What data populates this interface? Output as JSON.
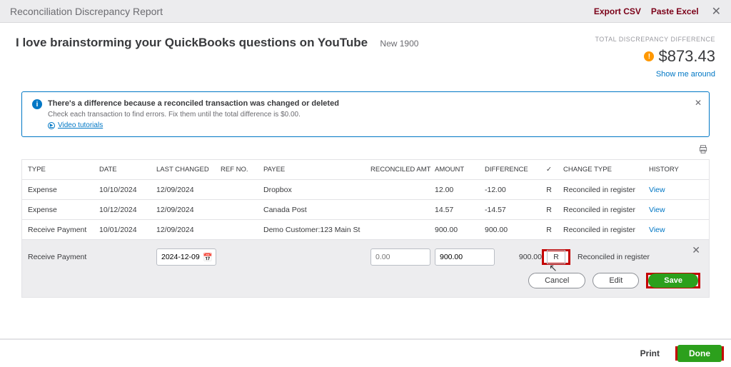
{
  "topbar": {
    "title": "Reconciliation Discrepancy Report",
    "export_csv": "Export CSV",
    "paste_excel": "Paste Excel"
  },
  "header": {
    "headline": "I love brainstorming your QuickBooks questions on YouTube",
    "sub": "New 1900",
    "caption": "TOTAL DISCREPANCY DIFFERENCE",
    "amount": "$873.43",
    "showme": "Show me around"
  },
  "alert": {
    "strong": "There's a difference because a reconciled transaction was changed or deleted",
    "sub": "Check each transaction to find errors. Fix them until the total difference is $0.00.",
    "video": "Video tutorials"
  },
  "columns": {
    "type": "TYPE",
    "date": "DATE",
    "last": "LAST CHANGED",
    "ref": "REF NO.",
    "payee": "PAYEE",
    "recon": "RECONCILED AMT",
    "amt": "AMOUNT",
    "diff": "DIFFERENCE",
    "chk": "✓",
    "ctype": "CHANGE TYPE",
    "hist": "HISTORY"
  },
  "rows": [
    {
      "type": "Expense",
      "date": "10/10/2024",
      "last": "12/09/2024",
      "ref": "",
      "payee": "Dropbox",
      "recon": "",
      "amt": "12.00",
      "diff": "-12.00",
      "chk": "R",
      "ctype": "Reconciled in register",
      "hist": "View"
    },
    {
      "type": "Expense",
      "date": "10/12/2024",
      "last": "12/09/2024",
      "ref": "",
      "payee": "Canada Post",
      "recon": "",
      "amt": "14.57",
      "diff": "-14.57",
      "chk": "R",
      "ctype": "Reconciled in register",
      "hist": "View"
    },
    {
      "type": "Receive Payment",
      "date": "10/01/2024",
      "last": "12/09/2024",
      "ref": "",
      "payee": "Demo Customer:123 Main St",
      "recon": "",
      "amt": "900.00",
      "diff": "900.00",
      "chk": "R",
      "ctype": "Reconciled in register",
      "hist": "View"
    }
  ],
  "edit": {
    "type": "Receive Payment",
    "date": "2024-12-09",
    "recon_placeholder": "0.00",
    "amt_value": "900.00",
    "diff": "900.00",
    "chk": "R",
    "ctype": "Reconciled in register",
    "cancel": "Cancel",
    "editbtn": "Edit",
    "save": "Save"
  },
  "footer": {
    "print": "Print",
    "done": "Done"
  }
}
